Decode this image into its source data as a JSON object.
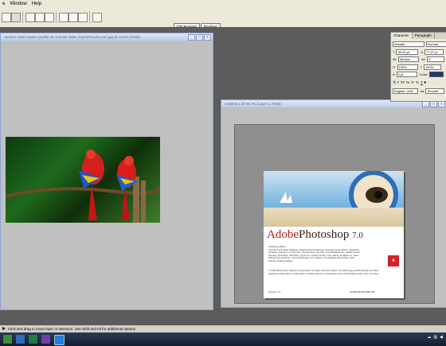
{
  "menubar": {
    "items": [
      "e",
      "Window",
      "Help"
    ]
  },
  "options_bar": {
    "palette_well": [
      "File Browser",
      "Brushes"
    ]
  },
  "window1": {
    "title": "Amazin Video Super Quality 4k Animals Video Top10Parrots.com.jpg @ 12.5% (RGB)",
    "controls": [
      "_",
      "□",
      "×"
    ]
  },
  "window2": {
    "title": "Untitled-1 @ 66.7% (Layer 1, RGB)",
    "controls": [
      "_",
      "□",
      "×"
    ]
  },
  "splash": {
    "brand_adobe": "Adobe",
    "brand_product": "Photoshop",
    "brand_version": "7.0",
    "credits_heading": "Initializing effects...",
    "credits": "Thomas Knoll, Mark Hamburg, Seetharaman Narayanan, Russell Preston Brown, Stephanie Schaefer, Zachary Lu, Chris Cox, Sandra Alves, Joe Ault, Vinod Balakrishnan, Jackie Lincoln-Owyang, Scott Byer, Jeff Chien, Chris Cox, Andrew Coven, Jerry Harris, Jonathan Lo, Sean Parent, John Peterson, John Worthington, Jon Clauson, Ted Alspach, Bob Archer, Todd Gilmore, Andrew Hadley...",
    "legal": "© 1990-2002 Adobe Systems Incorporated. All rights reserved. Adobe, the Adobe logo and Photoshop are either registered trademarks or trademarks of Adobe Systems Incorporated in the United States and/or other countries.",
    "version_label": "Version 7.0",
    "serial": "1045029970034987506",
    "logo_text": "Adobe"
  },
  "character_palette": {
    "tabs": [
      "Character",
      "Paragraph"
    ],
    "font_family": "Ahsadh",
    "font_style": "Normal",
    "font_size": "34.03 pt",
    "leading": "77.07 pt",
    "kerning": "Metrics",
    "tracking": "0",
    "vertical_scale": "100%",
    "horizontal_scale": "100%",
    "baseline": "0 pt",
    "color_label": "Color:",
    "style_buttons": [
      "T",
      "T",
      "TT",
      "Tт",
      "T¹",
      "T₁",
      "T",
      "T"
    ],
    "language": "English: USA",
    "antialias": "Smooth",
    "accent_color": "#1b3a78"
  },
  "status_bar": {
    "text": "Click and drag to move layer or selection. Use Shift and Alt for additional options."
  },
  "taskbar": {
    "colors": [
      "#3a8f3a",
      "#2c6ebd",
      "#1e7b45",
      "#6b3fb0",
      "#1f7fd6"
    ]
  }
}
